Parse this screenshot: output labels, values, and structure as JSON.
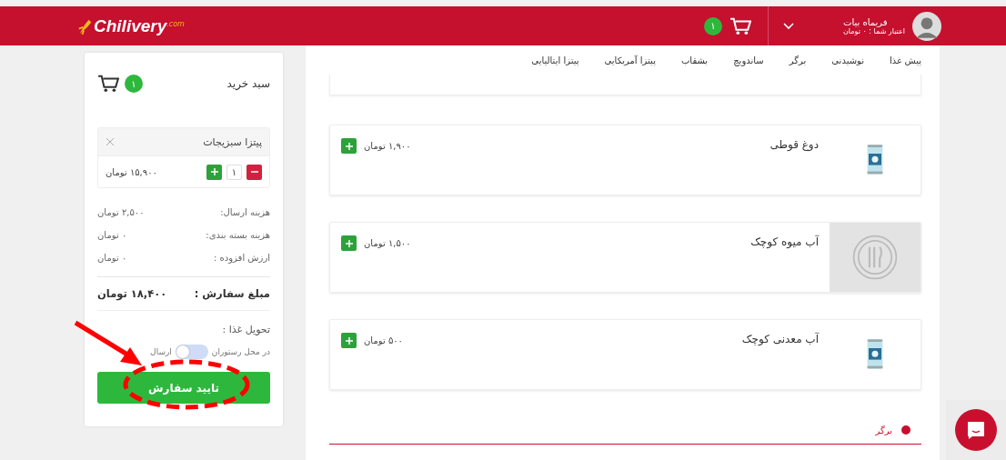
{
  "header": {
    "logo": "Chilivery",
    "logo_sup": ".com",
    "cart_count": "۱",
    "user": {
      "name": "فریماه بیات",
      "credit": "اعتبار شما : ۰ تومان"
    }
  },
  "cart": {
    "title": "سبد خرید",
    "count": "۱",
    "items": [
      {
        "name": "پیتزا سبزیجات",
        "quantity": "۱",
        "price": "۱۵,۹۰۰ تومان"
      }
    ],
    "fees": [
      {
        "label": "هزینه ارسال:",
        "value": "۲,۵۰۰ تومان"
      },
      {
        "label": "هزینه بسته بندی:",
        "value": "۰ تومان"
      },
      {
        "label": "ارزش افزوده :",
        "value": "۰ تومان"
      }
    ],
    "total": {
      "label": "مبلغ سفارش :",
      "value": "۱۸,۴۰۰ تومان"
    },
    "delivery": {
      "label": "تحویل غذا :",
      "option_a": "در محل رستوران",
      "option_b": "ارسال",
      "on": false
    },
    "confirm": "تایید سفارش"
  },
  "nav": [
    {
      "label": "پیش غذا"
    },
    {
      "label": "نوشیدنی"
    },
    {
      "label": "برگر"
    },
    {
      "label": "ساندویچ"
    },
    {
      "label": "بشقاب"
    },
    {
      "label": "پیتزا آمریکایی"
    },
    {
      "label": "پیتزا ایتالیایی"
    }
  ],
  "products": [
    {
      "name": "دوغ قوطی",
      "price": "۱,۹۰۰ تومان",
      "kind": "picture"
    },
    {
      "name": "آب میوه کوچک",
      "price": "۱,۵۰۰ تومان",
      "kind": "placeholder"
    },
    {
      "name": "آب معدنی کوچک",
      "price": "۵۰۰ تومان",
      "kind": "picture"
    }
  ],
  "section": {
    "title": "برگر",
    "color": "#c8102e"
  }
}
